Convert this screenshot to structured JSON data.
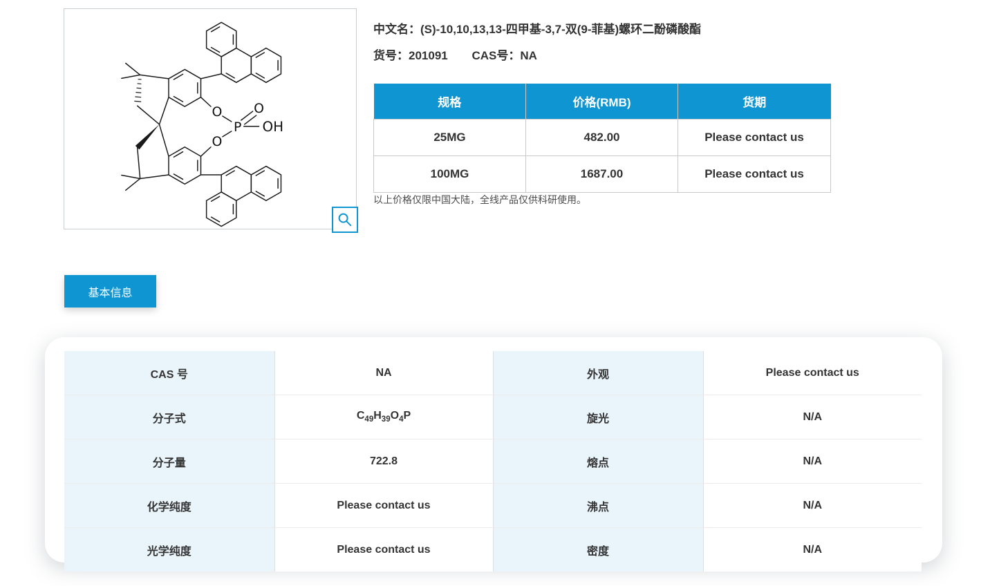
{
  "accent_color": "#1095d3",
  "label_cell_color": "#e9f4fb",
  "product": {
    "name_label": "中文名：",
    "name": "(S)-10,10,13,13-四甲基-3,7-双(9-菲基)螺环二酚磷酸酯",
    "item_label": "货号：",
    "item_no": "201091",
    "cas_label": "CAS号：",
    "cas_value": "NA"
  },
  "price": {
    "headers": [
      "规格",
      "价格(RMB)",
      "货期"
    ],
    "rows": [
      [
        "25MG",
        "482.00",
        "Please contact us"
      ],
      [
        "100MG",
        "1687.00",
        "Please contact us"
      ]
    ],
    "note": "以上价格仅限中国大陆，全线产品仅供科研使用。"
  },
  "tab": {
    "basic_info": "基本信息"
  },
  "info": {
    "rows": [
      [
        "CAS 号",
        "NA",
        "外观",
        "Please contact us"
      ],
      [
        "分子式",
        "",
        "旋光",
        "N/A"
      ],
      [
        "分子量",
        "722.8",
        "熔点",
        "N/A"
      ],
      [
        "化学纯度",
        "Please contact us",
        "沸点",
        "N/A"
      ],
      [
        "光学纯度",
        "Please contact us",
        "密度",
        "N/A"
      ]
    ]
  },
  "formula": {
    "c": "C",
    "cn": "49",
    "h": "H",
    "hn": "39",
    "o": "O",
    "on": "4",
    "p": "P"
  },
  "molecule_labels": {
    "o1": "O",
    "o2": "O",
    "o3": "O",
    "p": "P",
    "oh": "OH"
  }
}
